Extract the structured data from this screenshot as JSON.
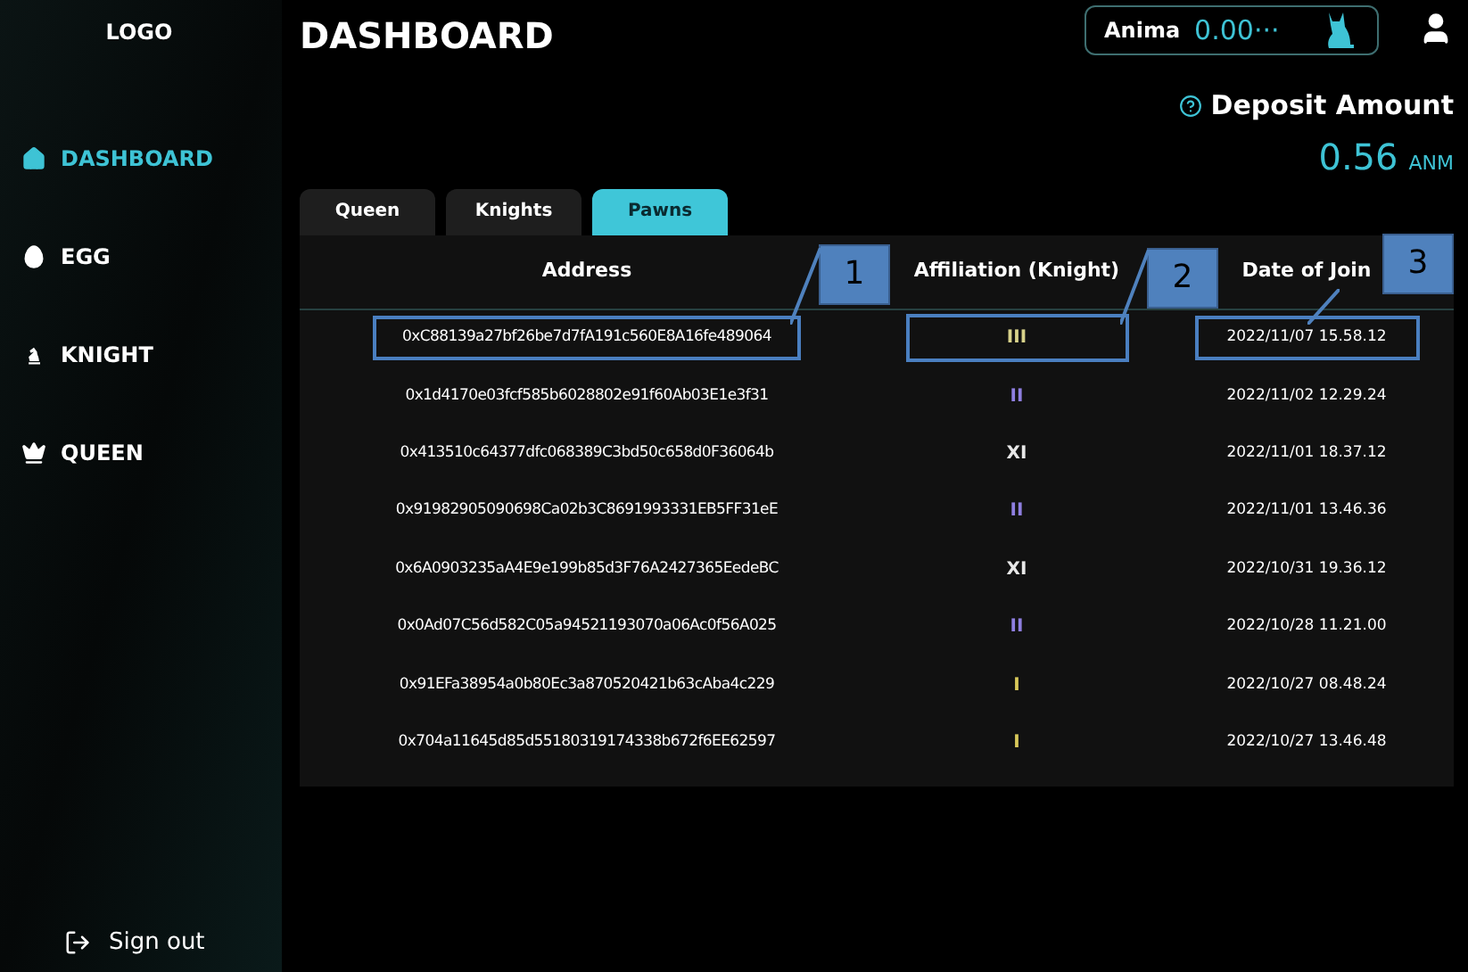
{
  "sidebar": {
    "logo": "LOGO",
    "items": [
      {
        "label": "DASHBOARD",
        "selected": true
      },
      {
        "label": "EGG",
        "selected": false
      },
      {
        "label": "KNIGHT",
        "selected": false
      },
      {
        "label": "QUEEN",
        "selected": false
      }
    ],
    "sign_out": "Sign out"
  },
  "header": {
    "title": "DASHBOARD",
    "wallet": {
      "label": "Anima",
      "value": "0.00···"
    }
  },
  "deposit": {
    "label": "Deposit Amount",
    "value": "0.56",
    "unit": "ANM"
  },
  "tabs": [
    {
      "label": "Queen",
      "selected": false
    },
    {
      "label": "Knights",
      "selected": false
    },
    {
      "label": "Pawns",
      "selected": true
    }
  ],
  "table": {
    "columns": [
      "Address",
      "Affiliation (Knight)",
      "Date of Join"
    ],
    "rows": [
      {
        "address": "0xC88139a27bf26be7d7fA191c560E8A16fe489064",
        "affiliation": "III",
        "color": "#d8d28a",
        "date": "2022/11/07 15.58.12",
        "highlighted": true
      },
      {
        "address": "0x1d4170e03fcf585b6028802e91f60Ab03E1e3f31",
        "affiliation": "II",
        "color": "#8f7fe0",
        "date": "2022/11/02 12.29.24",
        "highlighted": false
      },
      {
        "address": "0x413510c64377dfc068389C3bd50c658d0F36064b",
        "affiliation": "XI",
        "color": "#e8e8e8",
        "date": "2022/11/01 18.37.12",
        "highlighted": false
      },
      {
        "address": "0x91982905090698Ca02b3C8691993331EB5FF31eE",
        "affiliation": "II",
        "color": "#8f7fe0",
        "date": "2022/11/01 13.46.36",
        "highlighted": false
      },
      {
        "address": "0x6A0903235aA4E9e199b85d3F76A2427365EedeBC",
        "affiliation": "XI",
        "color": "#e8e8e8",
        "date": "2022/10/31 19.36.12",
        "highlighted": false
      },
      {
        "address": "0x0Ad07C56d582C05a94521193070a06Ac0f56A025",
        "affiliation": "II",
        "color": "#8f7fe0",
        "date": "2022/10/28 11.21.00",
        "highlighted": false
      },
      {
        "address": "0x91EFa38954a0b80Ec3a870520421b63cAba4c229",
        "affiliation": "I",
        "color": "#d8c85a",
        "date": "2022/10/27 08.48.24",
        "highlighted": false
      },
      {
        "address": "0x704a11645d85d55180319174338b672f6EE62597",
        "affiliation": "I",
        "color": "#d8c85a",
        "date": "2022/10/27 13.46.48",
        "highlighted": false
      }
    ]
  },
  "callouts": [
    "1",
    "2",
    "3"
  ]
}
